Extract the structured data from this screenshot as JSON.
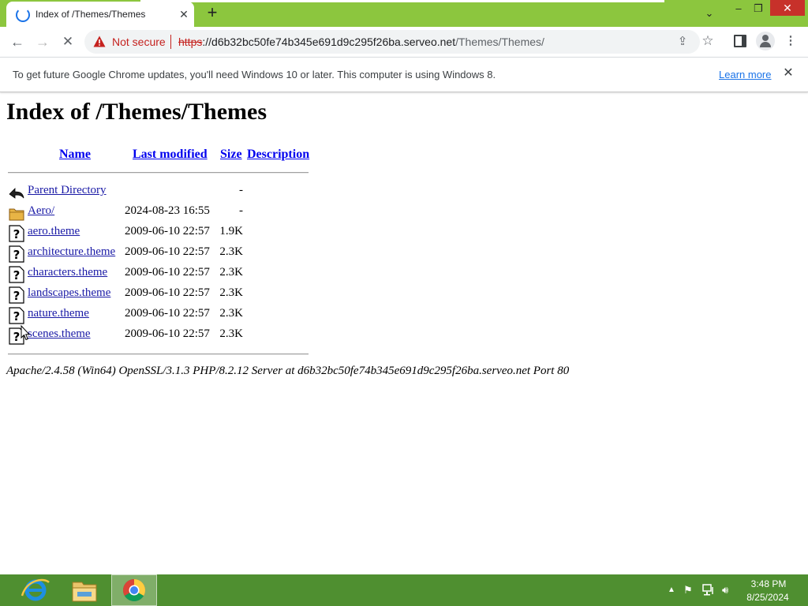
{
  "browser": {
    "tab_title": "Index of /Themes/Themes",
    "security_label": "Not secure",
    "url_scheme": "https",
    "url_host": "://d6b32bc50fe74b345e691d9c295f26ba.serveo.net",
    "url_path": "/Themes/Themes/"
  },
  "infobar": {
    "message": "To get future Google Chrome updates, you'll need Windows 10 or later. This computer is using Windows 8.",
    "link_label": "Learn more"
  },
  "page": {
    "heading": "Index of /Themes/Themes",
    "columns": {
      "name": "Name",
      "modified": "Last modified",
      "size": "Size",
      "description": "Description"
    },
    "rows": [
      {
        "icon": "back-icon",
        "name": "Parent Directory",
        "modified": "",
        "size": "-"
      },
      {
        "icon": "folder-icon",
        "name": "Aero/",
        "modified": "2024-08-23 16:55",
        "size": "-"
      },
      {
        "icon": "unknown-icon",
        "name": "aero.theme",
        "modified": "2009-06-10 22:57",
        "size": "1.9K"
      },
      {
        "icon": "unknown-icon",
        "name": "architecture.theme",
        "modified": "2009-06-10 22:57",
        "size": "2.3K"
      },
      {
        "icon": "unknown-icon",
        "name": "characters.theme",
        "modified": "2009-06-10 22:57",
        "size": "2.3K"
      },
      {
        "icon": "unknown-icon",
        "name": "landscapes.theme",
        "modified": "2009-06-10 22:57",
        "size": "2.3K"
      },
      {
        "icon": "unknown-icon",
        "name": "nature.theme",
        "modified": "2009-06-10 22:57",
        "size": "2.3K"
      },
      {
        "icon": "unknown-icon",
        "name": "scenes.theme",
        "modified": "2009-06-10 22:57",
        "size": "2.3K"
      }
    ],
    "server_signature": "Apache/2.4.58 (Win64) OpenSSL/3.1.3 PHP/8.2.12 Server at d6b32bc50fe74b345e691d9c295f26ba.serveo.net Port 80"
  },
  "taskbar": {
    "pinned": [
      "internet-explorer-icon",
      "file-explorer-icon",
      "chrome-icon"
    ],
    "clock_time": "3:48 PM",
    "clock_date": "8/25/2024"
  },
  "colors": {
    "tabbar_bg": "#8cc63e",
    "taskbar_bg": "#4f8f30",
    "link": "#1a1aa6",
    "warning": "#c5221f",
    "close_button": "#c7312a"
  }
}
